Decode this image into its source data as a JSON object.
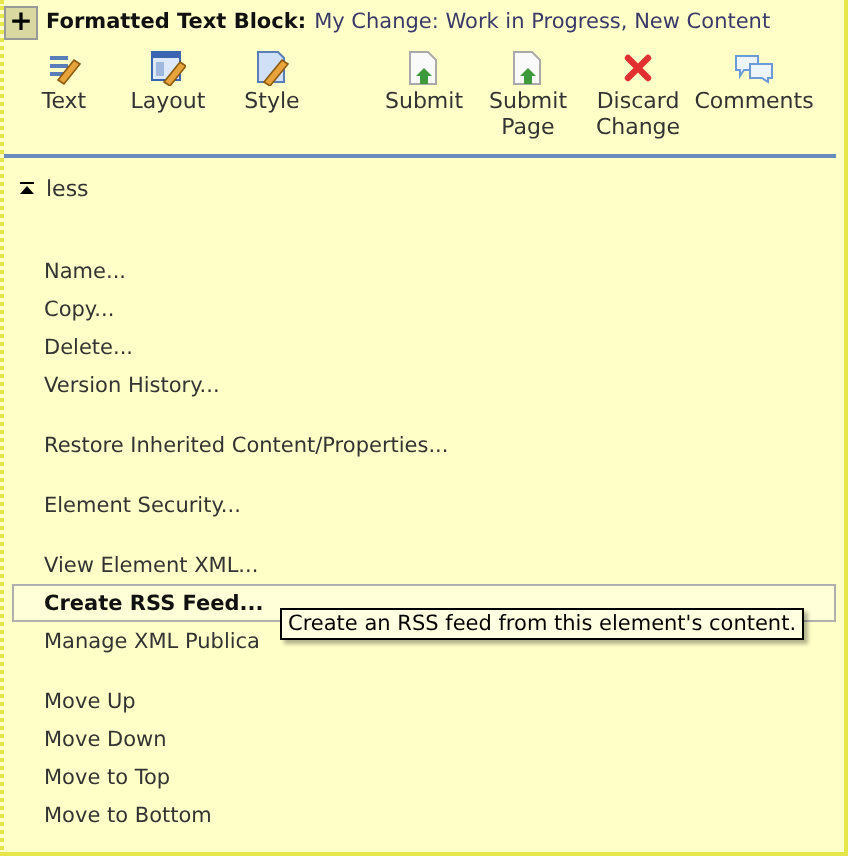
{
  "header": {
    "expand_symbol": "+",
    "title": "Formatted Text Block:",
    "status": "My Change: Work in Progress, New Content"
  },
  "toolbar": [
    [
      {
        "kind": "text",
        "label": "Text"
      },
      {
        "kind": "layout",
        "label": "Layout"
      },
      {
        "kind": "style",
        "label": "Style"
      }
    ],
    [
      {
        "kind": "submit",
        "label": "Submit"
      },
      {
        "kind": "submit",
        "label": "Submit Page"
      },
      {
        "kind": "discard",
        "label": "Discard Change"
      },
      {
        "kind": "comments",
        "label": "Comments"
      }
    ]
  ],
  "toggle": {
    "label": "less",
    "expanded": true
  },
  "menu": [
    [
      {
        "label": "Name...",
        "selected": false
      },
      {
        "label": "Copy...",
        "selected": false
      },
      {
        "label": "Delete...",
        "selected": false
      },
      {
        "label": "Version History...",
        "selected": false
      }
    ],
    [
      {
        "label": "Restore Inherited Content/Properties...",
        "selected": false
      }
    ],
    [
      {
        "label": "Element Security...",
        "selected": false
      }
    ],
    [
      {
        "label": "View Element XML...",
        "selected": false
      },
      {
        "label": "Create RSS Feed...",
        "selected": true
      },
      {
        "label": "Manage XML Publica",
        "selected": false
      }
    ],
    [
      {
        "label": "Move Up",
        "selected": false
      },
      {
        "label": "Move Down",
        "selected": false
      },
      {
        "label": "Move to Top",
        "selected": false
      },
      {
        "label": "Move to Bottom",
        "selected": false
      }
    ]
  ],
  "tooltip": {
    "text": "Create an RSS feed from this element's content."
  }
}
